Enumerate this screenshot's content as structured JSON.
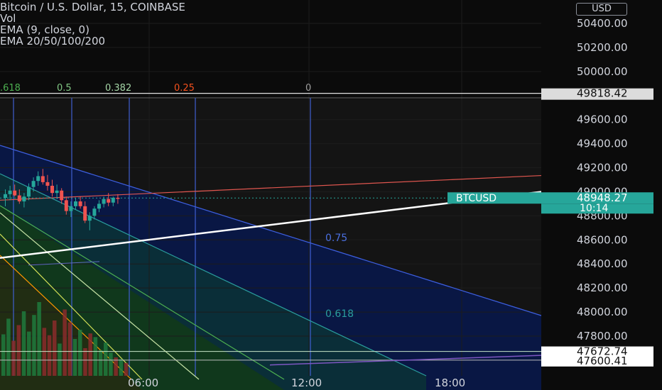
{
  "legend": {
    "symbol": "Bitcoin / U.S. Dollar, 15, COINBASE",
    "vol": "Vol",
    "ema1": "EMA (9, close, 0)",
    "ema2": "EMA 20/50/100/200"
  },
  "currency_button": "USD",
  "fib_top_labels": [
    {
      "text": ".618",
      "color": "#4caf50"
    },
    {
      "text": "0.5",
      "color": "#81c784"
    },
    {
      "text": "0.382",
      "color": "#a5d6a7"
    },
    {
      "text": "0.25",
      "color": "#f4511e"
    },
    {
      "text": "0",
      "color": "#9e9e9e"
    }
  ],
  "fan_labels": [
    {
      "text": "0.75",
      "price": 48590
    },
    {
      "text": "0.618",
      "price": 47960
    }
  ],
  "price_tags": {
    "top": "49818.42",
    "current_symbol": "BTCUSD",
    "current_price": "48948.27",
    "countdown": "10:14",
    "low1": "47672.74",
    "low2": "47600.41"
  },
  "chart_data": {
    "type": "candlestick",
    "title": "Bitcoin / U.S. Dollar, 15, COINBASE",
    "xlabel": "",
    "ylabel": "",
    "y_ticks": [
      50400,
      50200,
      50000,
      49600,
      49400,
      49200,
      49000,
      48800,
      48600,
      48400,
      48200,
      48000,
      47800
    ],
    "ylim": [
      47560,
      50580
    ],
    "x_ticks": [
      "06:00",
      "12:00",
      "18:00"
    ],
    "current_price": 48948.27,
    "fib_levels": [
      "0.618",
      "0.5",
      "0.382",
      "0.25",
      "0",
      "0.75",
      "0.618"
    ],
    "candles": [
      {
        "o": 48950,
        "h": 49020,
        "l": 48880,
        "c": 48980
      },
      {
        "o": 48980,
        "h": 49050,
        "l": 48930,
        "c": 49010
      },
      {
        "o": 49010,
        "h": 49060,
        "l": 48960,
        "c": 48970
      },
      {
        "o": 48970,
        "h": 49020,
        "l": 48900,
        "c": 48920
      },
      {
        "o": 48920,
        "h": 48990,
        "l": 48870,
        "c": 48960
      },
      {
        "o": 48960,
        "h": 49070,
        "l": 48930,
        "c": 49040
      },
      {
        "o": 49040,
        "h": 49120,
        "l": 49000,
        "c": 49090
      },
      {
        "o": 49090,
        "h": 49170,
        "l": 49050,
        "c": 49130
      },
      {
        "o": 49130,
        "h": 49190,
        "l": 49060,
        "c": 49080
      },
      {
        "o": 49080,
        "h": 49140,
        "l": 49010,
        "c": 49050
      },
      {
        "o": 49050,
        "h": 49100,
        "l": 48960,
        "c": 48990
      },
      {
        "o": 48990,
        "h": 49060,
        "l": 48940,
        "c": 49010
      },
      {
        "o": 49010,
        "h": 49030,
        "l": 48900,
        "c": 48930
      },
      {
        "o": 48930,
        "h": 48960,
        "l": 48810,
        "c": 48840
      },
      {
        "o": 48840,
        "h": 48920,
        "l": 48790,
        "c": 48880
      },
      {
        "o": 48880,
        "h": 48950,
        "l": 48850,
        "c": 48920
      },
      {
        "o": 48920,
        "h": 48960,
        "l": 48860,
        "c": 48880
      },
      {
        "o": 48880,
        "h": 48920,
        "l": 48740,
        "c": 48760
      },
      {
        "o": 48760,
        "h": 48830,
        "l": 48680,
        "c": 48800
      },
      {
        "o": 48800,
        "h": 48880,
        "l": 48770,
        "c": 48860
      },
      {
        "o": 48860,
        "h": 48930,
        "l": 48830,
        "c": 48900
      },
      {
        "o": 48900,
        "h": 48960,
        "l": 48870,
        "c": 48940
      },
      {
        "o": 48940,
        "h": 48990,
        "l": 48880,
        "c": 48910
      },
      {
        "o": 48910,
        "h": 48960,
        "l": 48880,
        "c": 48950
      },
      {
        "o": 48950,
        "h": 48980,
        "l": 48900,
        "c": 48948
      }
    ],
    "volumes": [
      0.45,
      0.62,
      0.38,
      0.55,
      0.7,
      0.48,
      0.66,
      0.8,
      0.52,
      0.44,
      0.6,
      0.35,
      0.72,
      0.58,
      0.4,
      0.5,
      0.3,
      0.46,
      0.42,
      0.28,
      0.36,
      0.25,
      0.2,
      0.18,
      0.14
    ]
  }
}
